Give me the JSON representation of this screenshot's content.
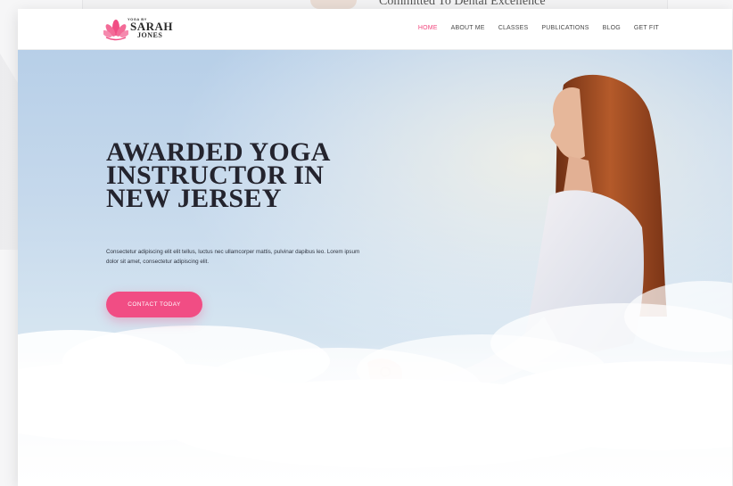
{
  "background_page": {
    "heading": "Committed To Dental Excellence"
  },
  "brand": {
    "small_text": "YOGA BY",
    "name_line1": "SARAH",
    "name_line2": "JONES",
    "accent_color": "#f14d84"
  },
  "nav": {
    "items": [
      {
        "label": "HOME",
        "active": true
      },
      {
        "label": "ABOUT ME",
        "active": false
      },
      {
        "label": "CLASSES",
        "active": false
      },
      {
        "label": "PUBLICATIONS",
        "active": false
      },
      {
        "label": "BLOG",
        "active": false
      },
      {
        "label": "GET FIT",
        "active": false
      }
    ]
  },
  "hero": {
    "title": "AWARDED YOGA INSTRUCTOR IN NEW JERSEY",
    "text": "Consectetur adipiscing elit elit tellus, luctus nec ullamcorper mattis, pulvinar dapibus leo. Lorem ipsum dolor sit amet, consectetur adipiscing elit.",
    "cta_label": "CONTACT TODAY"
  }
}
